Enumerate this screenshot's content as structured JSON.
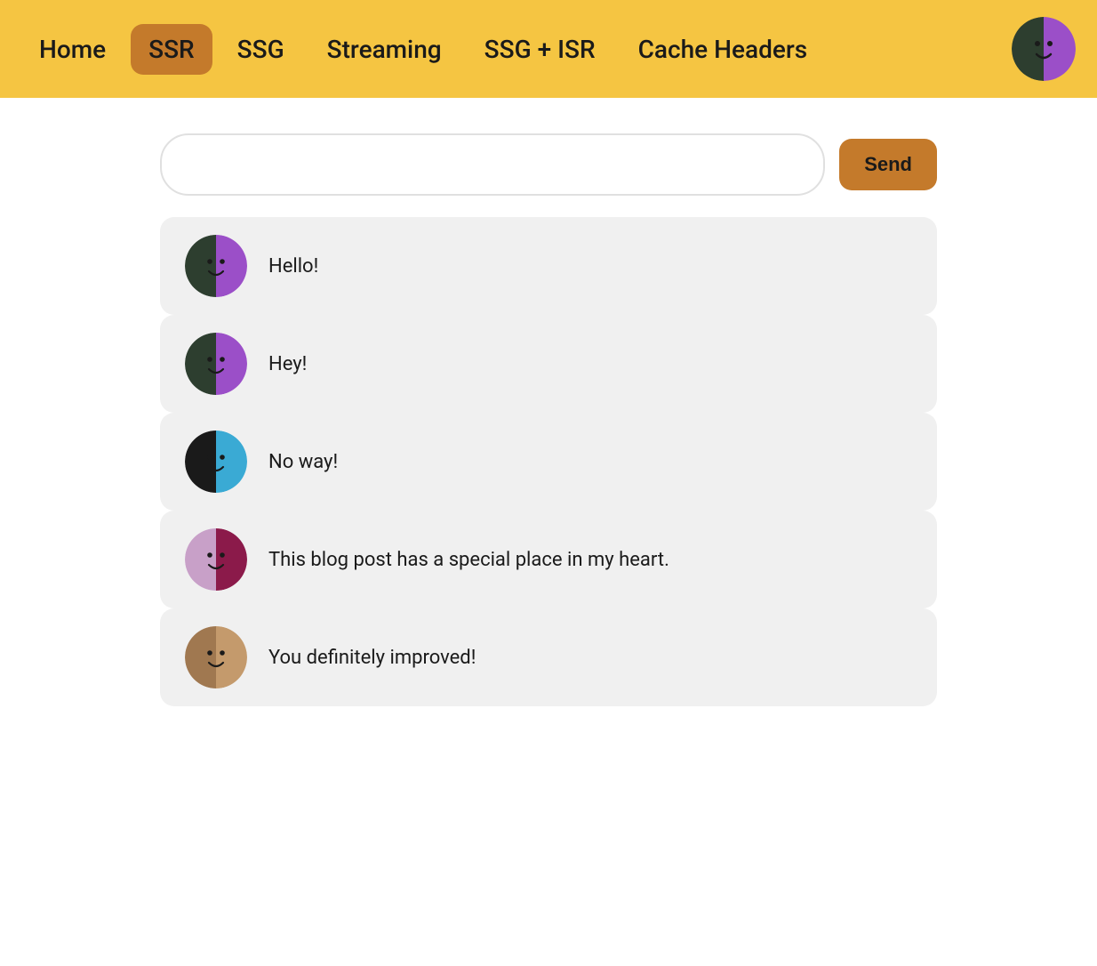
{
  "nav": {
    "items": [
      {
        "id": "home",
        "label": "Home",
        "active": false
      },
      {
        "id": "ssr",
        "label": "SSR",
        "active": true
      },
      {
        "id": "ssg",
        "label": "SSG",
        "active": false
      },
      {
        "id": "streaming",
        "label": "Streaming",
        "active": false
      },
      {
        "id": "ssg-isr",
        "label": "SSG + ISR",
        "active": false
      },
      {
        "id": "cache-headers",
        "label": "Cache Headers",
        "active": false
      }
    ],
    "avatar_color_primary": "#9B4FC8",
    "avatar_color_secondary": "#2D3E2F"
  },
  "main": {
    "input": {
      "placeholder": "",
      "value": ""
    },
    "send_button_label": "Send",
    "messages": [
      {
        "id": 1,
        "text": "Hello!",
        "avatar_primary": "#9B4FC8",
        "avatar_secondary": "#2D3E2F"
      },
      {
        "id": 2,
        "text": "Hey!",
        "avatar_primary": "#9B4FC8",
        "avatar_secondary": "#2D3E2F"
      },
      {
        "id": 3,
        "text": "No way!",
        "avatar_primary": "#3AAAD4",
        "avatar_secondary": "#1a1a1a"
      },
      {
        "id": 4,
        "text": "This blog post has a special place in my heart.",
        "avatar_primary": "#8B1A4A",
        "avatar_secondary": "#C8A0C8"
      },
      {
        "id": 5,
        "text": "You definitely improved!",
        "avatar_primary": "#C49A6C",
        "avatar_secondary": "#A07850"
      }
    ]
  }
}
